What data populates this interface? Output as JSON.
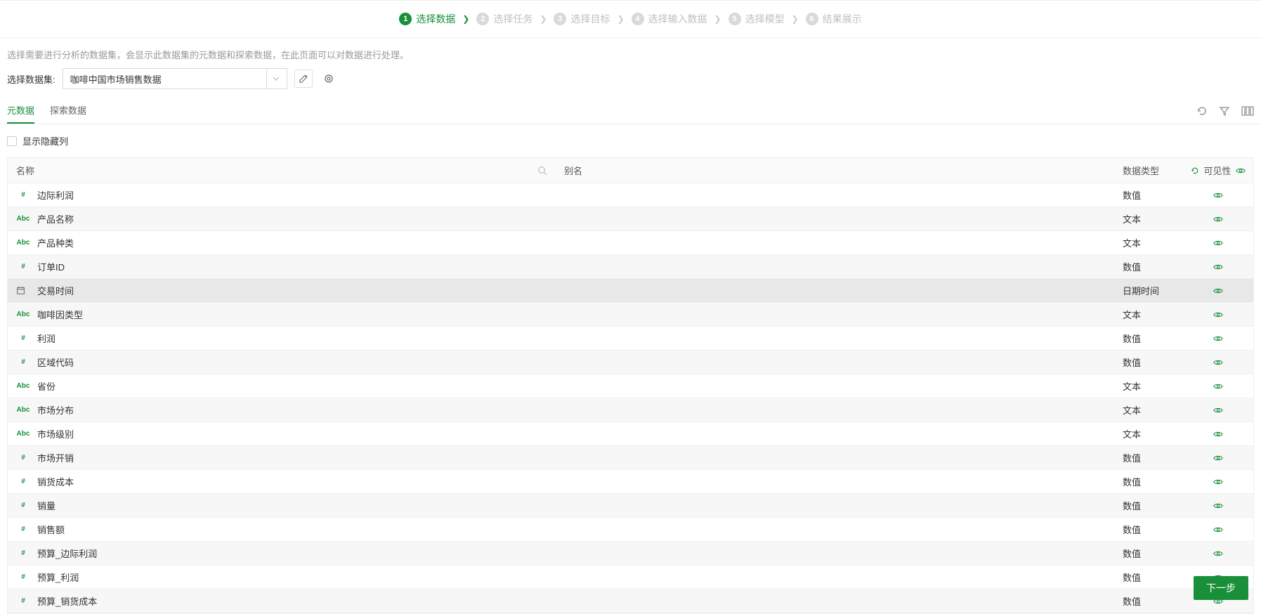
{
  "steps": [
    {
      "num": "1",
      "label": "选择数据",
      "active": true
    },
    {
      "num": "2",
      "label": "选择任务",
      "active": false
    },
    {
      "num": "3",
      "label": "选择目标",
      "active": false
    },
    {
      "num": "4",
      "label": "选择输入数据",
      "active": false
    },
    {
      "num": "5",
      "label": "选择模型",
      "active": false
    },
    {
      "num": "6",
      "label": "结果展示",
      "active": false
    }
  ],
  "description": "选择需要进行分析的数据集，会显示此数据集的元数据和探索数据，在此页面可以对数据进行处理。",
  "selector": {
    "label": "选择数据集:",
    "value": "咖啡中国市场销售数据"
  },
  "tabs": {
    "meta": "元数据",
    "explore": "探索数据"
  },
  "checkbox": {
    "label": "显示隐藏列"
  },
  "headers": {
    "name": "名称",
    "alias": "别名",
    "type": "数据类型",
    "visibility": "可见性"
  },
  "rows": [
    {
      "icon": "#",
      "iconKind": "num",
      "name": "边际利润",
      "type": "数值",
      "selected": false
    },
    {
      "icon": "Abc",
      "iconKind": "text",
      "name": "产品名称",
      "type": "文本",
      "selected": false
    },
    {
      "icon": "Abc",
      "iconKind": "text",
      "name": "产品种类",
      "type": "文本",
      "selected": false
    },
    {
      "icon": "#",
      "iconKind": "num",
      "name": "订单ID",
      "type": "数值",
      "selected": false
    },
    {
      "icon": "cal",
      "iconKind": "calendar",
      "name": "交易时间",
      "type": "日期时间",
      "selected": true
    },
    {
      "icon": "Abc",
      "iconKind": "text",
      "name": "咖啡因类型",
      "type": "文本",
      "selected": false
    },
    {
      "icon": "#",
      "iconKind": "num",
      "name": "利润",
      "type": "数值",
      "selected": false
    },
    {
      "icon": "#",
      "iconKind": "num",
      "name": "区域代码",
      "type": "数值",
      "selected": false
    },
    {
      "icon": "Abc",
      "iconKind": "text",
      "name": "省份",
      "type": "文本",
      "selected": false
    },
    {
      "icon": "Abc",
      "iconKind": "text",
      "name": "市场分布",
      "type": "文本",
      "selected": false
    },
    {
      "icon": "Abc",
      "iconKind": "text",
      "name": "市场级别",
      "type": "文本",
      "selected": false
    },
    {
      "icon": "#",
      "iconKind": "num",
      "name": "市场开销",
      "type": "数值",
      "selected": false
    },
    {
      "icon": "#",
      "iconKind": "num",
      "name": "销货成本",
      "type": "数值",
      "selected": false
    },
    {
      "icon": "#",
      "iconKind": "num",
      "name": "销量",
      "type": "数值",
      "selected": false
    },
    {
      "icon": "#",
      "iconKind": "num",
      "name": "销售额",
      "type": "数值",
      "selected": false
    },
    {
      "icon": "#",
      "iconKind": "num",
      "name": "预算_边际利润",
      "type": "数值",
      "selected": false
    },
    {
      "icon": "#",
      "iconKind": "num",
      "name": "预算_利润",
      "type": "数值",
      "selected": false
    },
    {
      "icon": "#",
      "iconKind": "num",
      "name": "预算_销货成本",
      "type": "数值",
      "selected": false
    }
  ],
  "footer": {
    "next": "下一步"
  }
}
